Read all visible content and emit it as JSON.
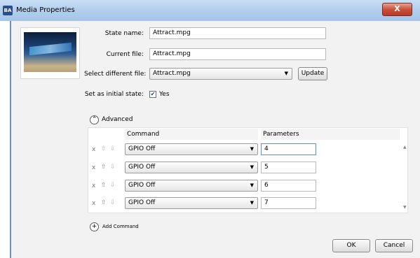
{
  "window": {
    "title": "Media Properties",
    "app_icon": "media-app-icon",
    "close_glyph": "X"
  },
  "form": {
    "state_name_label": "State name:",
    "state_name_value": "Attract.mpg",
    "current_file_label": "Current file:",
    "current_file_value": "Attract.mpg",
    "select_file_label": "Select different file:",
    "select_file_value": "Attract.mpg",
    "update_label": "Update",
    "initial_state_label": "Set as initial state:",
    "initial_state_checked": true,
    "initial_state_value": "Yes"
  },
  "advanced": {
    "label": "Advanced",
    "expanded": true,
    "columns": {
      "command": "Command",
      "parameters": "Parameters"
    },
    "rows": [
      {
        "remove": "x",
        "command": "GPIO Off",
        "parameter": "4"
      },
      {
        "remove": "x",
        "command": "GPIO Off",
        "parameter": "5"
      },
      {
        "remove": "x",
        "command": "GPIO Off",
        "parameter": "6"
      },
      {
        "remove": "x",
        "command": "GPIO Off",
        "parameter": "7"
      }
    ],
    "add_command_label": "Add Command"
  },
  "footer": {
    "ok_label": "OK",
    "cancel_label": "Cancel"
  }
}
